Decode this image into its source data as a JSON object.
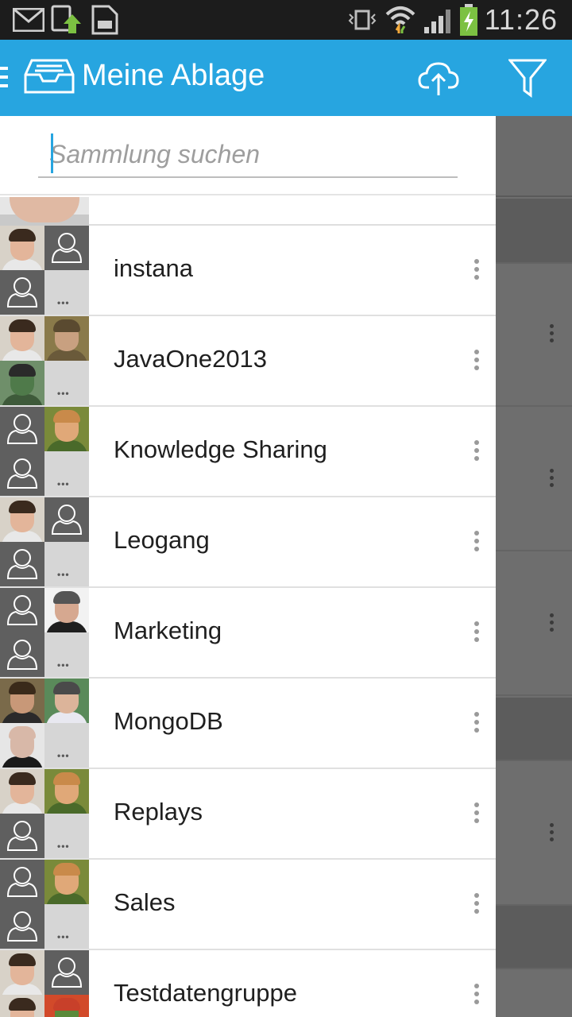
{
  "status_bar": {
    "time": "11:26",
    "icons": [
      "gmail-icon",
      "download-icon",
      "sd-card-icon",
      "vibrate-icon",
      "wifi-icon",
      "signal-icon",
      "battery-charging-icon"
    ]
  },
  "app_bar": {
    "title": "Meine Ablage",
    "icons": [
      "menu-icon",
      "tray-icon",
      "upload-cloud-icon",
      "filter-icon"
    ],
    "color": "#27a5e0"
  },
  "search": {
    "placeholder": "Sammlung suchen",
    "value": ""
  },
  "collections": [
    {
      "label": "instana",
      "tiles": [
        "photo-a",
        "placeholder",
        "placeholder",
        "more"
      ]
    },
    {
      "label": "JavaOne2013",
      "tiles": [
        "photo-a",
        "photo-c",
        "photo-d",
        "more"
      ]
    },
    {
      "label": "Knowledge Sharing",
      "tiles": [
        "placeholder",
        "photo-b",
        "placeholder",
        "more"
      ]
    },
    {
      "label": "Leogang",
      "tiles": [
        "photo-a",
        "placeholder",
        "placeholder",
        "more"
      ]
    },
    {
      "label": "Marketing",
      "tiles": [
        "placeholder",
        "photo-e",
        "placeholder",
        "more"
      ]
    },
    {
      "label": "MongoDB",
      "tiles": [
        "photo-f",
        "photo-g",
        "photo-h",
        "more"
      ]
    },
    {
      "label": "Replays",
      "tiles": [
        "photo-a",
        "photo-b",
        "placeholder",
        "more"
      ]
    },
    {
      "label": "Sales",
      "tiles": [
        "placeholder",
        "photo-b",
        "placeholder",
        "more"
      ]
    },
    {
      "label": "Testdatengruppe",
      "tiles": [
        "photo-a",
        "placeholder",
        "photo-a",
        "photo-i"
      ]
    }
  ]
}
